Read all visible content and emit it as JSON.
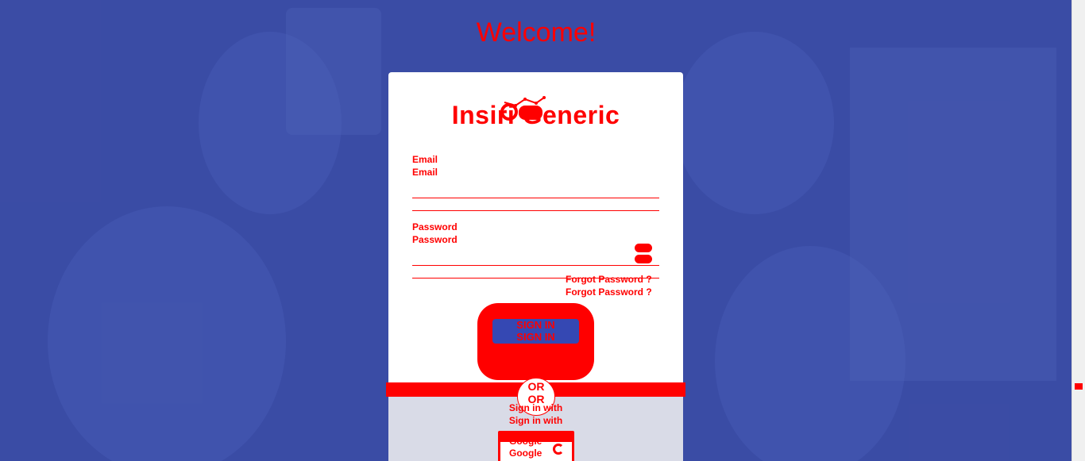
{
  "page": {
    "welcome": "Welcome!",
    "brand": "Insiri Generic"
  },
  "form": {
    "email_label": "Email",
    "email_label_dup": "Email",
    "password_label": "Password",
    "password_label_dup": "Password",
    "forgot": "Forgot Password ?",
    "forgot_dup": "Forgot Password ?",
    "signin": "SIGN IN",
    "signin_dup": "SIGN IN"
  },
  "social": {
    "or": "OR",
    "or_dup": "OR",
    "signin_with": "Sign in with",
    "signin_with_dup": "Sign in with",
    "google": "Google",
    "google_dup": "Google"
  },
  "colors": {
    "accent": "#ff0000",
    "background": "#2f3f9a",
    "button": "#3548b3"
  },
  "icons": {
    "logo": "chart-line-icon",
    "password_toggle": "eye-icon",
    "google": "google-g-icon"
  }
}
